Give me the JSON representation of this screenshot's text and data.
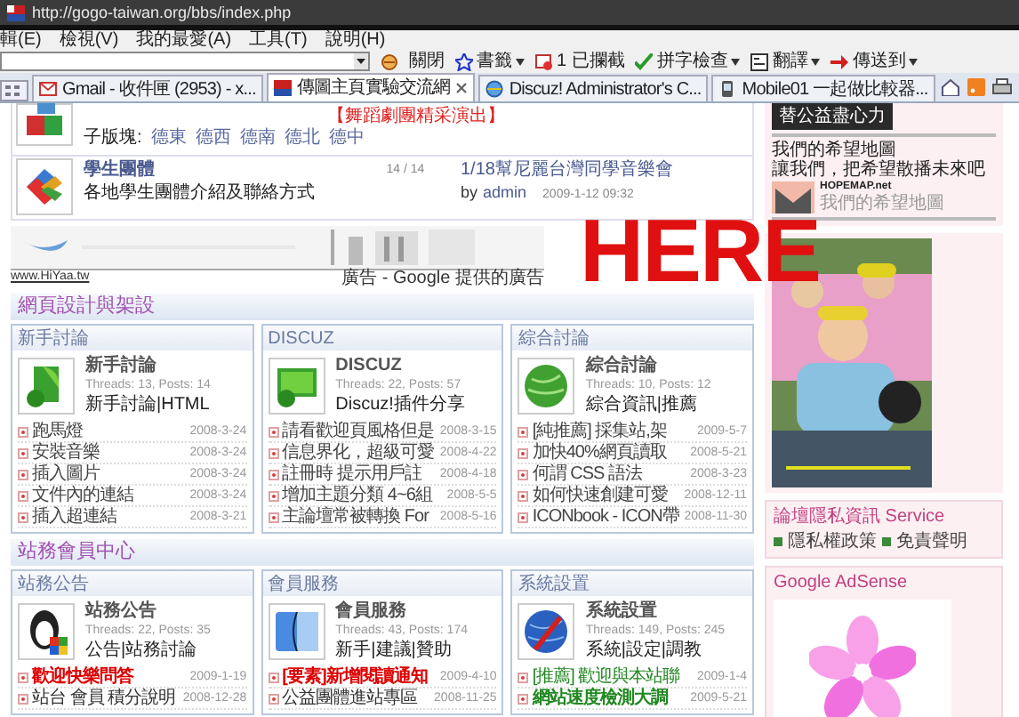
{
  "browser": {
    "url": "http://gogo-taiwan.org/bbs/index.php",
    "menu": [
      "輯(E)",
      "檢視(V)",
      "我的最愛(A)",
      "工具(T)",
      "說明(H)"
    ],
    "toolbar": [
      {
        "kind": "plain",
        "label": "關閉",
        "dropdown": false
      },
      {
        "kind": "bookmarks",
        "label": "書籤",
        "dropdown": true
      },
      {
        "kind": "popup",
        "label": "1 已攔截",
        "dropdown": false
      },
      {
        "kind": "spell",
        "label": "拼字檢查",
        "dropdown": true
      },
      {
        "kind": "translate",
        "label": "翻譯",
        "dropdown": true
      },
      {
        "kind": "send",
        "label": "傳送到",
        "dropdown": true
      }
    ],
    "tabs": [
      {
        "kind": "gmail",
        "title": "Gmail - 收件匣 (2953) - x...",
        "selected": false
      },
      {
        "kind": "site",
        "title": "傳圖主頁實驗交流網",
        "selected": true
      },
      {
        "kind": "ie",
        "title": "Discuz! Administrator's C...",
        "selected": false
      },
      {
        "kind": "mobile",
        "title": "Mobile01 一起做比較器...",
        "selected": false
      }
    ]
  },
  "page": {
    "forum_partial": {
      "announcement": "【舞蹈劇團精采演出】",
      "subforums_label": "子版塊:",
      "subforums": [
        "德東",
        "德西",
        "德南",
        "德北",
        "德中"
      ]
    },
    "forum": {
      "name": "學生團體",
      "description": "各地學生團體介紹及聯絡方式",
      "counts": "14 / 14",
      "last_post": "1/18幫尼麗台灣同學音樂會",
      "by": "by",
      "author": "admin",
      "time": "2009-1-12 09:32"
    },
    "ad": {
      "site": "www.HiYaa.tw",
      "label": "廣告 - Google 提供的廣告"
    },
    "annotation": "HERE",
    "sections": [
      {
        "title": "網頁設計與架設",
        "cards": [
          {
            "header": "新手討論",
            "kind": "leaf",
            "name": "新手討論",
            "stats": "Threads: 13, Posts: 14",
            "description": "新手討論|HTML",
            "posts": [
              {
                "title": "跑馬燈",
                "date": "2008-3-24"
              },
              {
                "title": "安裝音樂",
                "date": "2008-3-24"
              },
              {
                "title": "插入圖片",
                "date": "2008-3-24"
              },
              {
                "title": "文件內的連結",
                "date": "2008-3-24"
              },
              {
                "title": "插入超連結",
                "date": "2008-3-21"
              }
            ]
          },
          {
            "header": "DISCUZ",
            "kind": "monitor",
            "name": "DISCUZ",
            "stats": "Threads: 22, Posts: 57",
            "description": "Discuz!插件分享",
            "posts": [
              {
                "title": "請看歡迎頁風格但是",
                "date": "2008-3-15"
              },
              {
                "title": "信息界化，超級可愛",
                "date": "2008-4-22"
              },
              {
                "title": "註冊時 提示用戶註",
                "date": "2008-4-18"
              },
              {
                "title": "增加主題分類 4~6組",
                "date": "2008-5-5"
              },
              {
                "title": "主論壇常被轉換 For",
                "date": "2008-5-16"
              }
            ]
          },
          {
            "header": "綜合討論",
            "kind": "globe",
            "name": "綜合討論",
            "stats": "Threads: 10, Posts: 12",
            "description": "綜合資訊|推薦",
            "posts": [
              {
                "title": "[純推薦] 採集站,架",
                "date": "2009-5-7"
              },
              {
                "title": "加快40%網頁讀取",
                "date": "2008-5-21"
              },
              {
                "title": "何謂 CSS 語法",
                "date": "2008-3-23"
              },
              {
                "title": "如何快速創建可愛",
                "date": "2008-12-11"
              },
              {
                "title": "ICONbook - ICON帶",
                "date": "2008-11-30"
              }
            ]
          }
        ]
      },
      {
        "title": "站務會員中心",
        "cards": [
          {
            "header": "站務公告",
            "kind": "penguin",
            "name": "站務公告",
            "stats": "Threads: 22, Posts: 35",
            "description": "公告|站務討論",
            "posts": [
              {
                "title": "歡迎快樂問答",
                "date": "2009-1-19",
                "color": "#dd0000",
                "bold": true
              },
              {
                "title": "站台 會員 積分說明",
                "date": "2008-12-28",
                "color": "#333333",
                "bold": false
              }
            ]
          },
          {
            "header": "會員服務",
            "kind": "finder",
            "name": "會員服務",
            "stats": "Threads: 43, Posts: 174",
            "description": "新手|建議|贊助",
            "posts": [
              {
                "title": "[要素]新增閱讀通知",
                "date": "2009-4-10",
                "color": "#dd0000",
                "bold": true
              },
              {
                "title": "公益團體進站專區",
                "date": "2008-11-25",
                "color": "#333333",
                "bold": false
              }
            ]
          },
          {
            "header": "系統設置",
            "kind": "tools",
            "name": "系統設置",
            "stats": "Threads: 149, Posts: 245",
            "description": "系統|設定|調教",
            "posts": [
              {
                "title": "[推薦] 歡迎與本站聯",
                "date": "2009-1-4",
                "color": "#228822",
                "bold": false
              },
              {
                "title": "網站速度檢測大調",
                "date": "2009-5-21",
                "color": "#228822",
                "bold": true
              }
            ]
          }
        ]
      }
    ]
  },
  "sidebar": {
    "promo_button": "替公益盡心力",
    "promo_lines": [
      "我們的希望地圖",
      "讓我們，把希望散播未來吧"
    ],
    "logo_text": "HOPEMAP.net",
    "logo_caption": "我們的希望地圖",
    "service_title": "論壇隱私資訊 Service",
    "service_links": [
      "隱私權政策",
      "免責聲明"
    ],
    "adsense_title": "Google AdSense"
  }
}
